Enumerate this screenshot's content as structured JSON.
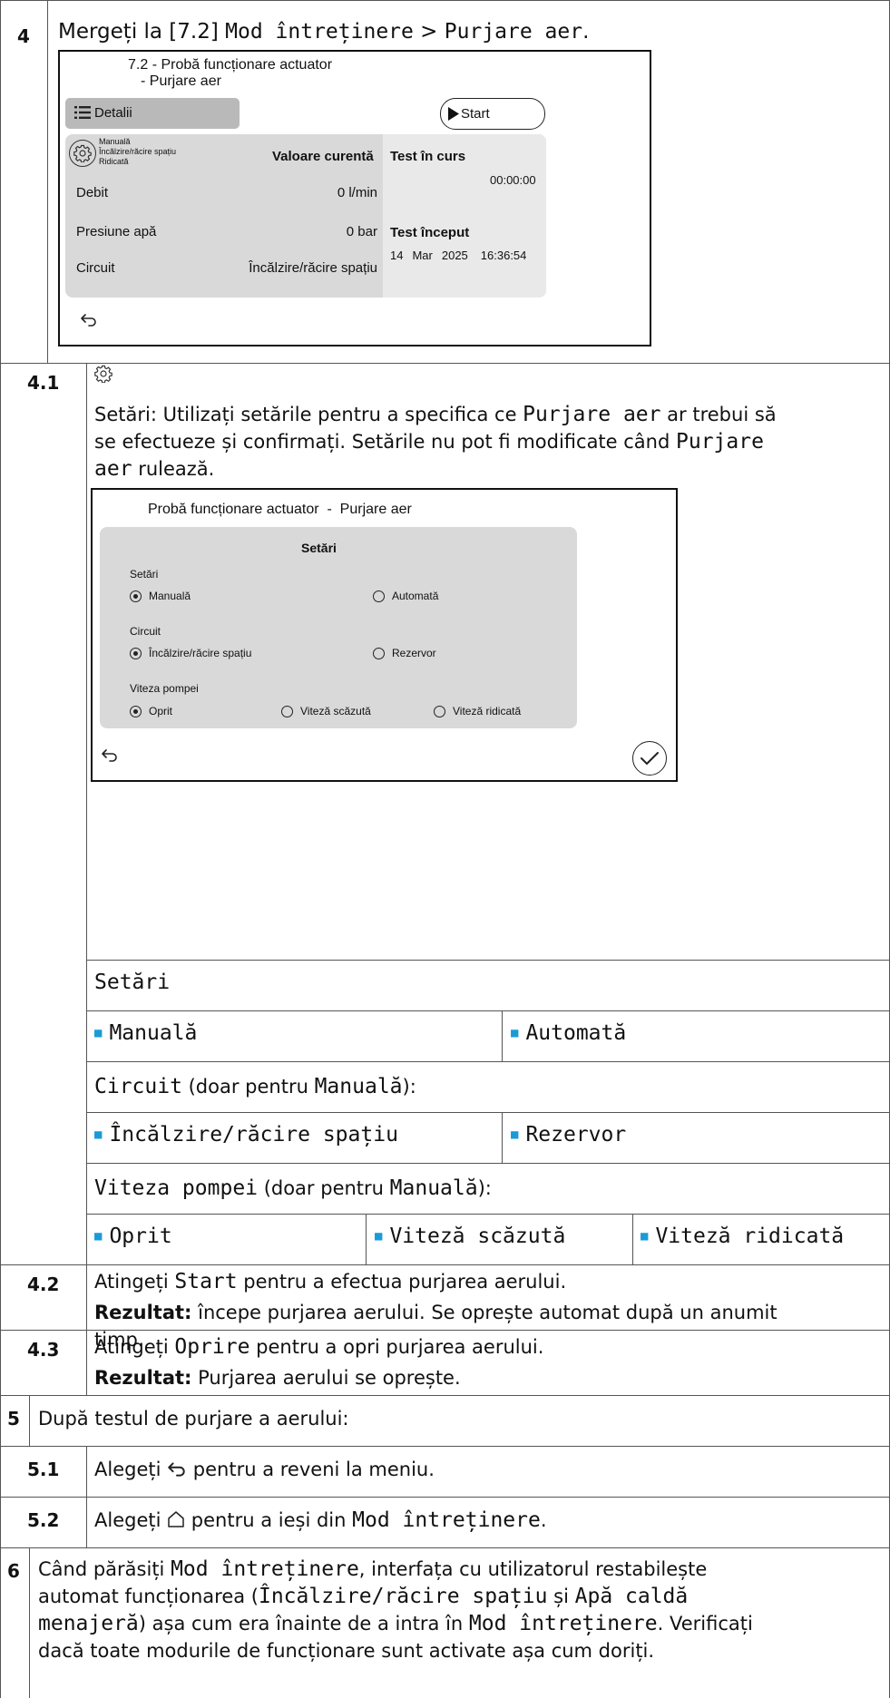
{
  "step4": {
    "num": "4",
    "go_prefix": "Mergeți la [7.2] ",
    "go_menu1": "Mod întreținere",
    "go_sep": " > ",
    "go_menu2": "Purjare aer",
    "go_end": "."
  },
  "screen1": {
    "title_line1": "7.2 - Probă funcționare actuator",
    "title_line2": "- Purjare aer",
    "details_label": "Detalii",
    "start_label": "Start",
    "settings_lines": [
      "Manuală",
      "Încălzire/răcire spațiu",
      "Ridicată"
    ],
    "current_value_header": "Valoare curentă",
    "test_running_header": "Test în curs",
    "timer": "00:00:00",
    "rows": [
      {
        "label": "Debit",
        "value": "0 l/min"
      },
      {
        "label": "Presiune apă",
        "value": "0 bar"
      },
      {
        "label": "Circuit",
        "value": "Încălzire/răcire spațiu"
      }
    ],
    "test_started_header": "Test început",
    "start_day": "14",
    "start_month": "Mar",
    "start_year": "2025",
    "start_time": "16:36:54"
  },
  "step41": {
    "num": "4.1",
    "p_a": "Setări: Utilizați setările pentru a specifica ce ",
    "p_b": "Purjare aer",
    "p_c": " ar trebui să",
    "p_d": "se efectueze și confirmați. Setările nu pot fi modificate când ",
    "p_e": "Purjare",
    "p_f": "aer",
    "p_g": " rulează."
  },
  "screen2": {
    "title": "Probă funcționare actuator  -  Purjare aer",
    "panel_title": "Setări",
    "group1_label": "Setări",
    "opt_manual": "Manuală",
    "opt_auto": "Automată",
    "group2_label": "Circuit",
    "opt_space": "Încălzire/răcire spațiu",
    "opt_tank": "Rezervor",
    "group3_label": "Viteza pompei",
    "opt_off": "Oprit",
    "opt_low": "Viteză scăzută",
    "opt_high": "Viteză ridicată"
  },
  "settings_table": {
    "header": "Setări",
    "row1": [
      "Manuală",
      "Automată"
    ],
    "circuit_label": "Circuit",
    "circuit_note_a": " (doar pentru ",
    "circuit_note_b": "Manuală",
    "circuit_note_c": "):",
    "row2": [
      "Încălzire/răcire spațiu",
      "Rezervor"
    ],
    "speed_label": "Viteza pompei",
    "speed_note_a": " (doar pentru ",
    "speed_note_b": "Manuală",
    "speed_note_c": "):",
    "row3": [
      "Oprit",
      "Viteză scăzută",
      "Viteză ridicată"
    ]
  },
  "step42": {
    "num": "4.2",
    "a": "Atingeți ",
    "b": "Start",
    "c": " pentru a efectua purjarea aerului.",
    "res_label": "Rezultat:",
    "res_a": "  începe purjarea aerului. Se oprește automat după un anumit",
    "res_b": "timp."
  },
  "step43": {
    "num": "4.3",
    "a": "Atingeți ",
    "b": "Oprire",
    "c": " pentru a opri purjarea aerului.",
    "res_label": "Rezultat:",
    "res_a": " Purjarea aerului se oprește."
  },
  "step5": {
    "num": "5",
    "text": "După testul de purjare a aerului:"
  },
  "step51": {
    "num": "5.1",
    "a": "Alegeți ",
    "b": " pentru a reveni la meniu."
  },
  "step52": {
    "num": "5.2",
    "a": "Alegeți ",
    "b": " pentru a ieși din ",
    "c": "Mod întreținere",
    "d": "."
  },
  "step6": {
    "num": "6",
    "l1a": "Când părăsiți ",
    "l1b": "Mod întreținere",
    "l1c": ", interfața cu utilizatorul restabilește",
    "l2a": "automat funcționarea (",
    "l2b": "Încălzire/răcire spațiu",
    "l2c": " și ",
    "l2d": "Apă caldă",
    "l3a": "menajeră",
    "l3b": ") așa cum era înainte de a intra în ",
    "l3c": "Mod întreținere",
    "l3d": ". Verificați",
    "l4": "dacă toate modurile de funcționare sunt activate așa cum doriți."
  },
  "colors": {
    "accent_bullet": "#1a9bd7",
    "panel_gray": "#d9d9d9"
  }
}
